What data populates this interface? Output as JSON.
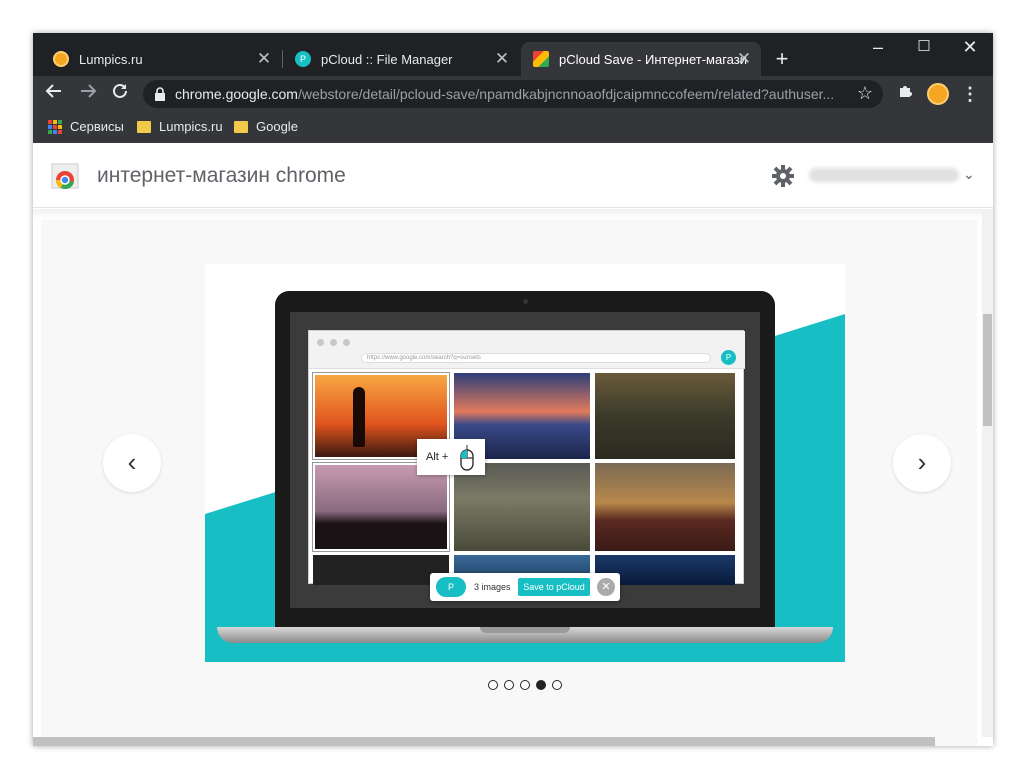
{
  "tabs": [
    {
      "title": "Lumpics.ru",
      "favicon": "orange-circle-icon"
    },
    {
      "title": "pCloud :: File Manager",
      "favicon": "pcloud-icon"
    },
    {
      "title": "pCloud Save - Интернет-магазин",
      "favicon": "webstore-icon",
      "active": true
    }
  ],
  "address_bar": {
    "host": "chrome.google.com",
    "path": "/webstore/detail/pcloud-save/npamdkabjncnnoaofdjcaipmnccofeem/related?authuser..."
  },
  "bookmarks": [
    {
      "label": "Сервисы",
      "icon": "apps-grid-icon"
    },
    {
      "label": "Lumpics.ru",
      "icon": "folder-icon"
    },
    {
      "label": "Google",
      "icon": "folder-icon"
    }
  ],
  "webstore": {
    "title": "интернет-магазин chrome"
  },
  "screenshot": {
    "mock_url": "https://www.google.com/search?q=sunsets",
    "alt_hint": "Alt +",
    "images_count": "3 images",
    "save_label": "Save to pCloud"
  },
  "carousel": {
    "total": 5,
    "active": 4
  },
  "colors": {
    "accent": "#17bfc4",
    "tabbar": "#202124",
    "toolbar": "#35363a"
  }
}
